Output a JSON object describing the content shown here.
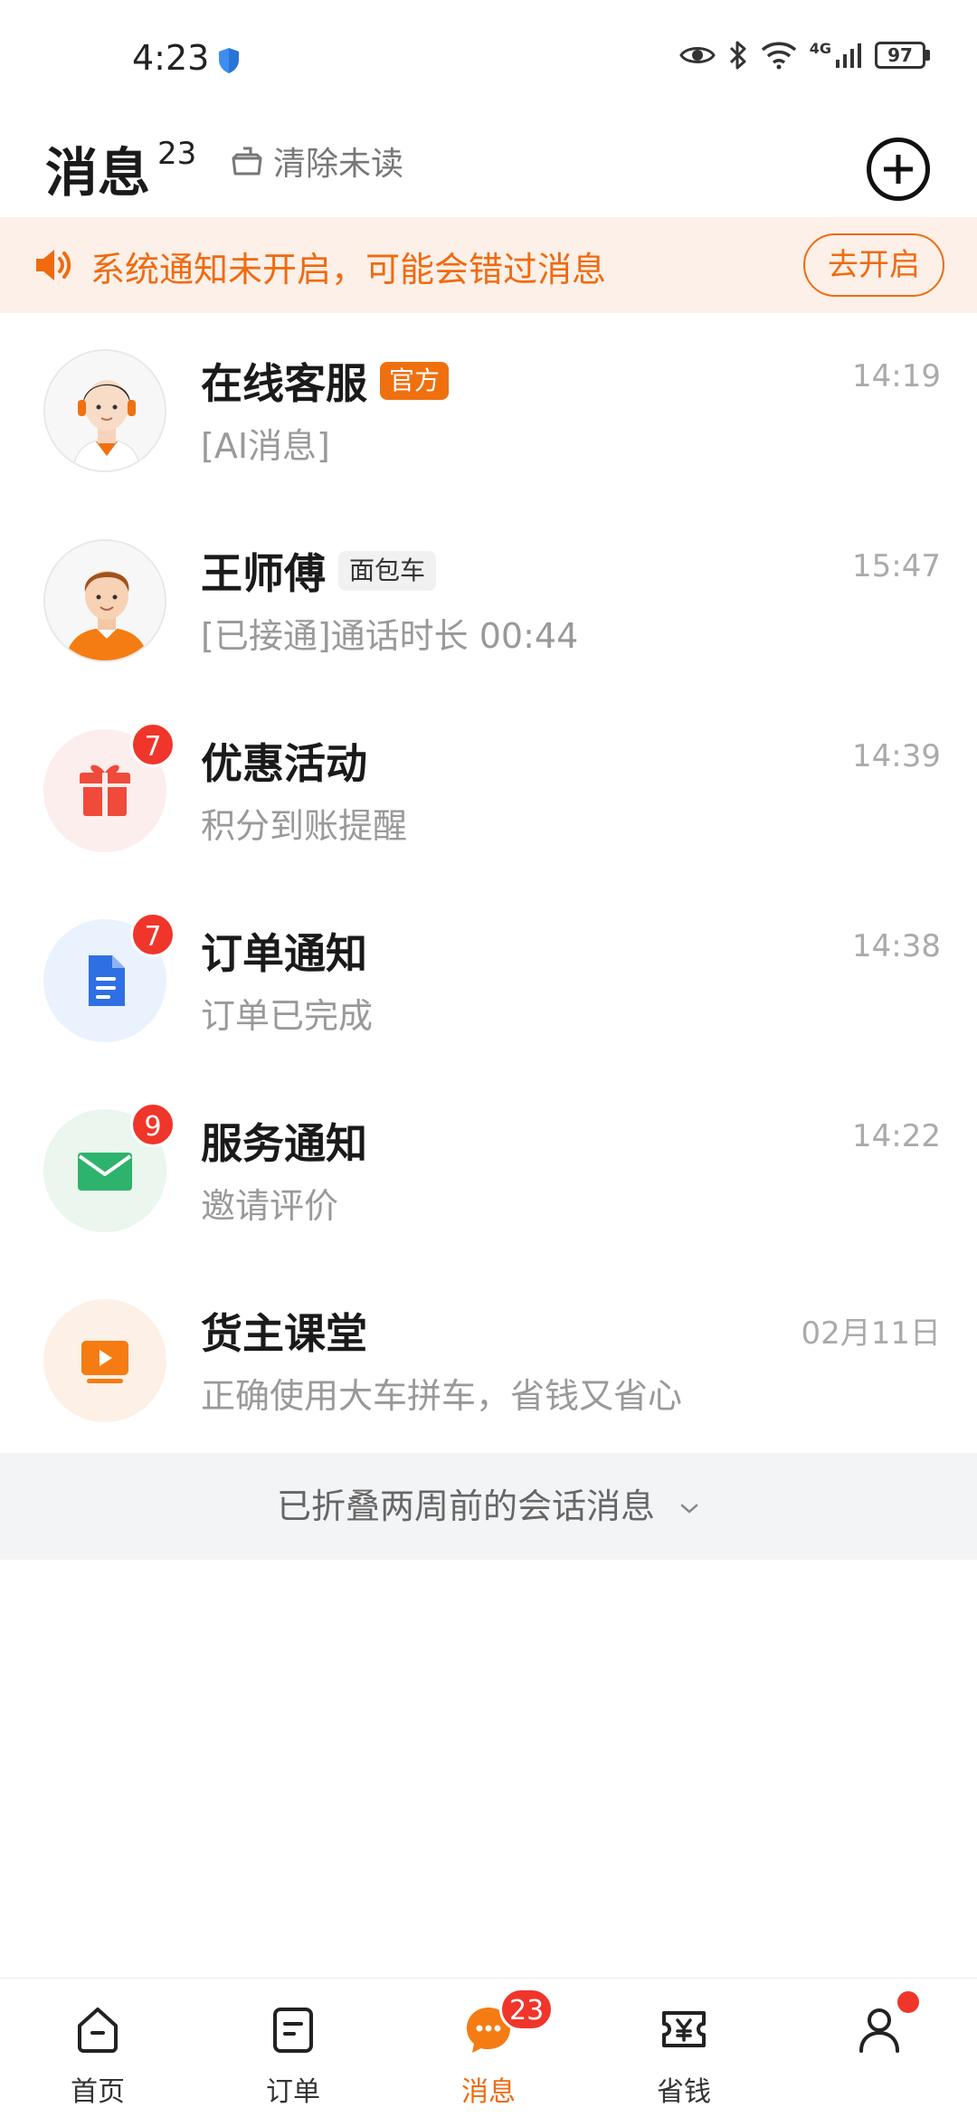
{
  "status_bar": {
    "time": "4:23",
    "network": "4G",
    "battery": "97"
  },
  "header": {
    "title": "消息",
    "unread_count": "23",
    "clear_unread_label": "清除未读"
  },
  "banner": {
    "text": "系统通知未开启，可能会错过消息",
    "button_label": "去开启",
    "accent_color": "#f06a10"
  },
  "conversations": [
    {
      "name": "在线客服",
      "tag": "官方",
      "preview": "[AI消息]",
      "time": "14:19",
      "badge": null,
      "avatar": "customer-service-avatar"
    },
    {
      "name": "王师傅",
      "tag": "面包车",
      "preview": "[已接通]通话时长 00:44",
      "time": "15:47",
      "badge": null,
      "avatar": "driver-avatar"
    },
    {
      "name": "优惠活动",
      "tag": null,
      "preview": "积分到账提醒",
      "time": "14:39",
      "badge": "7",
      "avatar": "gift-icon"
    },
    {
      "name": "订单通知",
      "tag": null,
      "preview": "订单已完成",
      "time": "14:38",
      "badge": "7",
      "avatar": "document-icon"
    },
    {
      "name": "服务通知",
      "tag": null,
      "preview": "邀请评价",
      "time": "14:22",
      "badge": "9",
      "avatar": "envelope-icon"
    },
    {
      "name": "货主课堂",
      "tag": null,
      "preview": "正确使用大车拼车，省钱又省心",
      "time": "02月11日",
      "badge": null,
      "avatar": "video-icon"
    }
  ],
  "fold_bar": {
    "label": "已折叠两周前的会话消息"
  },
  "bottom_nav": {
    "items": [
      {
        "label": "首页",
        "icon": "home-icon"
      },
      {
        "label": "订单",
        "icon": "order-icon"
      },
      {
        "label": "消息",
        "icon": "message-icon",
        "badge": "23",
        "active": true
      },
      {
        "label": "省钱",
        "icon": "coupon-icon"
      },
      {
        "label": "",
        "icon": "profile-icon",
        "dot": true
      }
    ]
  }
}
